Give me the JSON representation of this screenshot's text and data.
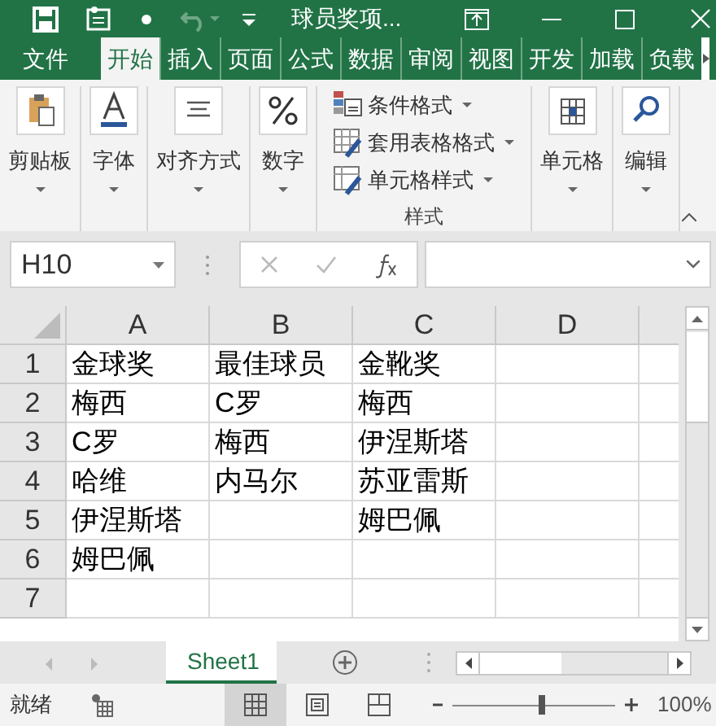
{
  "window": {
    "title": "球员奖项..."
  },
  "ribbon_tabs": [
    {
      "label": "文件",
      "selected": false
    },
    {
      "label": "开始",
      "selected": true
    },
    {
      "label": "插入",
      "selected": false
    },
    {
      "label": "页面",
      "selected": false
    },
    {
      "label": "公式",
      "selected": false
    },
    {
      "label": "数据",
      "selected": false
    },
    {
      "label": "审阅",
      "selected": false
    },
    {
      "label": "视图",
      "selected": false
    },
    {
      "label": "开发",
      "selected": false
    },
    {
      "label": "加载",
      "selected": false
    },
    {
      "label": "负载",
      "selected": false
    }
  ],
  "ribbon_groups": [
    {
      "kind": "big",
      "label": "剪贴板"
    },
    {
      "kind": "big",
      "label": "字体"
    },
    {
      "kind": "big",
      "label": "对齐方式"
    },
    {
      "kind": "big",
      "label": "数字"
    },
    {
      "kind": "styles",
      "label": "样式",
      "items": [
        "条件格式",
        "套用表格格式",
        "单元格样式"
      ]
    },
    {
      "kind": "big",
      "label": "单元格"
    },
    {
      "kind": "big",
      "label": "编辑"
    }
  ],
  "name_box": "H10",
  "columns": [
    "A",
    "B",
    "C",
    "D"
  ],
  "rows": [
    {
      "number": "1",
      "cells": [
        "金球奖",
        "最佳球员",
        "金靴奖",
        null
      ]
    },
    {
      "number": "2",
      "cells": [
        "梅西",
        "C罗",
        "梅西",
        null
      ]
    },
    {
      "number": "3",
      "cells": [
        "C罗",
        "梅西",
        "伊涅斯塔",
        null
      ]
    },
    {
      "number": "4",
      "cells": [
        "哈维",
        "内马尔",
        "苏亚雷斯",
        null
      ]
    },
    {
      "number": "5",
      "cells": [
        "伊涅斯塔",
        null,
        "姆巴佩",
        null
      ]
    },
    {
      "number": "6",
      "cells": [
        "姆巴佩",
        null,
        null,
        null
      ]
    },
    {
      "number": "7",
      "cells": [
        null,
        null,
        null,
        null
      ]
    }
  ],
  "sheet_tabs": [
    {
      "label": "Sheet1",
      "selected": true
    }
  ],
  "status_bar": {
    "status": "就绪",
    "views": [
      {
        "kind": "normal",
        "selected": true
      },
      {
        "kind": "layout",
        "selected": false
      },
      {
        "kind": "pagebreak",
        "selected": false
      }
    ],
    "zoom": {
      "level": 0.55,
      "reading": "100%"
    }
  }
}
